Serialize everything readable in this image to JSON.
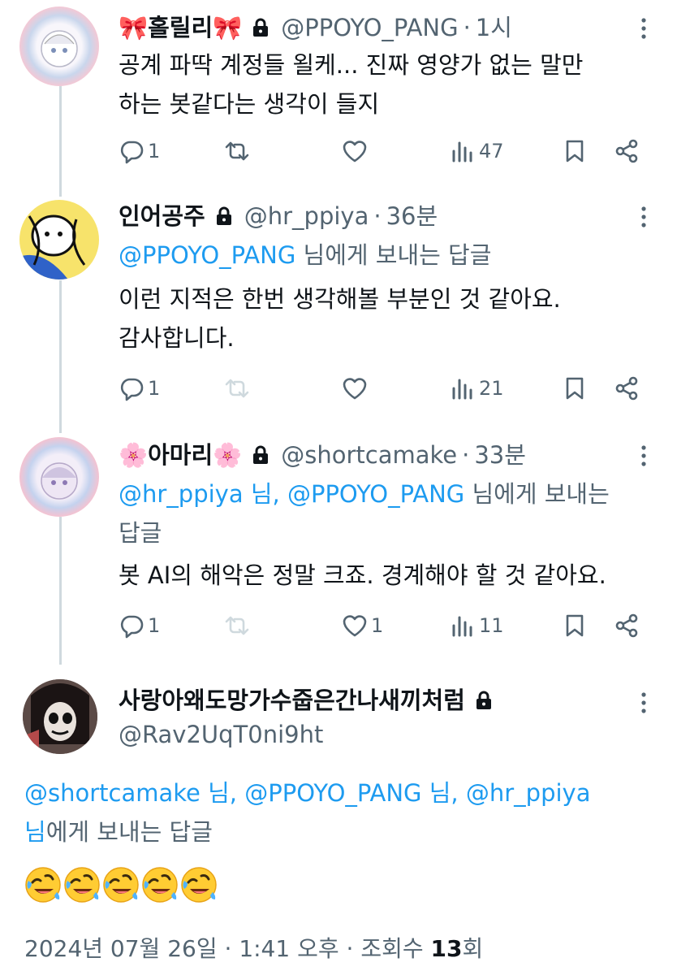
{
  "posts": [
    {
      "name": "🎀홀릴리🎀",
      "handle": "@PPOYO_PANG",
      "sep": "·",
      "time": "1시",
      "text_lines": [
        "공계 파딱 계정들 욀케... 진짜 영양가 없는 말만",
        "하는 봇같다는 생각이 들지"
      ],
      "replies": "1",
      "reposts": "",
      "likes": "",
      "views": "47"
    },
    {
      "name": "인어공주",
      "handle": "@hr_ppiya",
      "sep": "·",
      "time": "36분",
      "reply_mentions": "@PPOYO_PANG",
      "reply_suffix": " 님에게 보내는 답글",
      "text_lines": [
        "이런 지적은 한번 생각해볼 부분인 것 같아요.",
        "감사합니다."
      ],
      "replies": "1",
      "reposts": "",
      "likes": "",
      "views": "21"
    },
    {
      "name": "🌸아마리🌸",
      "handle": "@shortcamake",
      "sep": "·",
      "time": "33분",
      "reply_mention_1": "@hr_ppiya",
      "reply_mid_1": " 님, ",
      "reply_mention_2": "@PPOYO_PANG",
      "reply_suffix_1": " 님에게 보내는",
      "reply_suffix_2": "답글",
      "text_lines": [
        "봇 AI의 해악은 정말 크죠. 경계해야 할 것 같아요."
      ],
      "replies": "1",
      "reposts": "",
      "likes": "1",
      "views": "11"
    }
  ],
  "main": {
    "name": "사랑아왜도망가수줍은간나새끼처럼",
    "handle": "@Rav2UqT0ni9ht",
    "reply_mention_1": "@shortcamake",
    "reply_mid_1": " 님, ",
    "reply_mention_2": "@PPOYO_PANG",
    "reply_mid_2": " 님, ",
    "reply_mention_3": "@hr_ppiya",
    "reply_line2": "님에게 보내는 답글",
    "emoji_count": 5,
    "footer_date": "2024년 07월 26일",
    "footer_sep1": " · ",
    "footer_time": "1:41 오후",
    "footer_sep2": " · ",
    "footer_views_label": "조회수 ",
    "footer_views_count": "13",
    "footer_views_unit": "회"
  },
  "colors": {
    "accent": "#1d9bf0",
    "muted": "#536471",
    "text": "#0f1419",
    "line": "#cfd9de"
  },
  "icons": [
    "lock-icon",
    "more-icon",
    "reply-icon",
    "repost-icon",
    "like-icon",
    "views-icon",
    "bookmark-icon",
    "share-icon",
    "rofl-emoji"
  ]
}
